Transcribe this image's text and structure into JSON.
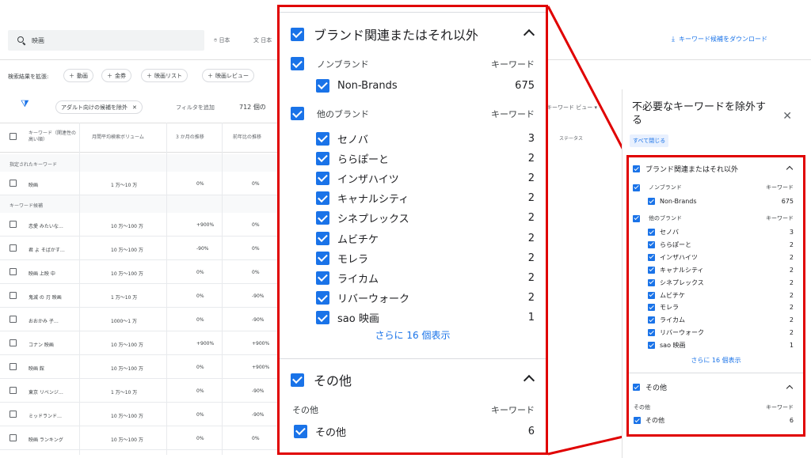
{
  "search": {
    "value": "映画"
  },
  "header": {
    "location": "日本",
    "language": "日本",
    "download_label": "キーワード候補をダウンロード"
  },
  "expand": {
    "label": "検索結果を拡張:",
    "chips": [
      "動画",
      "金券",
      "映画リスト",
      "映画レビュー"
    ]
  },
  "filters": {
    "adult_chip": "アダルト向けの候補を除外",
    "add_filter": "フィルタを追加",
    "count_text": "712 個の",
    "keyword_view": "キーワード ビュー"
  },
  "table": {
    "headers": [
      "キーワード（関連性の高い順）",
      "月間平均検索ボリューム",
      "3 か月の推移",
      "前年比の推移"
    ],
    "status_header": "ステータス",
    "group_provided": "指定されたキーワード",
    "group_ideas": "キーワード候補",
    "provided_rows": [
      {
        "kw": "映画",
        "vol": "1 万～10 万",
        "m3": "0%",
        "yoy": "0%"
      }
    ],
    "idea_rows": [
      {
        "kw": "恋愛 みたいな…",
        "vol": "10 万～100 万",
        "m3": "+900%",
        "yoy": "0%"
      },
      {
        "kw": "君 よ そばかす…",
        "vol": "10 万～100 万",
        "m3": "-90%",
        "yoy": "0%"
      },
      {
        "kw": "映画 上映 中",
        "vol": "10 万～100 万",
        "m3": "0%",
        "yoy": "0%"
      },
      {
        "kw": "鬼滅 の 刃 映画",
        "vol": "1 万～10 万",
        "m3": "0%",
        "yoy": "-90%"
      },
      {
        "kw": "おおかみ 子…",
        "vol": "1000～1 万",
        "m3": "0%",
        "yoy": "-90%"
      },
      {
        "kw": "コナン 映画",
        "vol": "10 万～100 万",
        "m3": "+900%",
        "yoy": "+900%"
      },
      {
        "kw": "映画 館",
        "vol": "10 万～100 万",
        "m3": "0%",
        "yoy": "+900%"
      },
      {
        "kw": "東京 リベンジ…",
        "vol": "1 万～10 万",
        "m3": "0%",
        "yoy": "-90%"
      },
      {
        "kw": "ミッドランド…",
        "vol": "10 万～100 万",
        "m3": "0%",
        "yoy": "-90%"
      },
      {
        "kw": "映画 ランキング",
        "vol": "10 万～100 万",
        "m3": "0%",
        "yoy": "0%"
      }
    ]
  },
  "drawer": {
    "title": "不必要なキーワードを除外する",
    "close_all": "すべて閉じる"
  },
  "exclusion": {
    "brand_section": "ブランド関連またはそれ以外",
    "non_brand_group": "ノンブランド",
    "keyword_col": "キーワード",
    "non_brand_item": {
      "label": "Non-Brands",
      "count": "675"
    },
    "other_brand_group": "他のブランド",
    "brands": [
      {
        "label": "セノバ",
        "count": "3"
      },
      {
        "label": "ららぽーと",
        "count": "2"
      },
      {
        "label": "インザハイツ",
        "count": "2"
      },
      {
        "label": "キャナルシティ",
        "count": "2"
      },
      {
        "label": "シネプレックス",
        "count": "2"
      },
      {
        "label": "ムビチケ",
        "count": "2"
      },
      {
        "label": "モレラ",
        "count": "2"
      },
      {
        "label": "ライカム",
        "count": "2"
      },
      {
        "label": "リバーウォーク",
        "count": "2"
      },
      {
        "label": "sao 映画",
        "count": "1"
      }
    ],
    "show_more": "さらに 16 個表示",
    "other_section": "その他",
    "other_group": "その他",
    "other_item": {
      "label": "その他",
      "count": "6"
    }
  },
  "colors": {
    "accent": "#1a73e8",
    "highlight": "#e00000"
  }
}
